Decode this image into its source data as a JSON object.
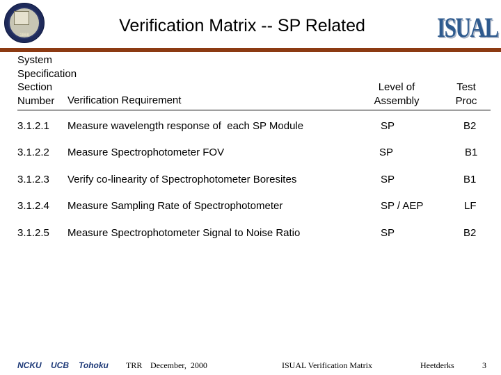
{
  "header": {
    "title": "Verification Matrix  -- SP Related",
    "seal_year": "1868",
    "logo_text": "ISUAL",
    "colors": {
      "rule": "#8c3a12",
      "logo": "#2e5a8e",
      "footer_institutions": "#1e3a78"
    }
  },
  "table": {
    "columns": {
      "section_line1": "System",
      "section_line2": "Specification",
      "section_line3": "Section",
      "section_line4": "Number",
      "requirement": "Verification Requirement",
      "level_line1": "Level of",
      "level_line2": "Assembly",
      "proc_line1": "Test",
      "proc_line2": "Proc"
    },
    "rows": [
      {
        "section": "3.1.2.1",
        "requirement": "Measure wavelength response of  each SP Module",
        "level": "SP",
        "proc": "B2"
      },
      {
        "section": "3.1.2.2",
        "requirement": "Measure Spectrophotometer FOV",
        "level": "SP",
        "proc": "B1"
      },
      {
        "section": "3.1.2.3",
        "requirement": "Verify co-linearity of Spectrophotometer Boresites",
        "level": "SP",
        "proc": "B1"
      },
      {
        "section": "3.1.2.4",
        "requirement": "Measure Sampling Rate of Spectrophotometer",
        "level": "SP / AEP",
        "proc": "LF"
      },
      {
        "section": "3.1.2.5",
        "requirement": "Measure Spectrophotometer Signal to Noise Ratio",
        "level": "SP",
        "proc": "B2"
      }
    ]
  },
  "footer": {
    "inst1": "NCKU",
    "inst2": "UCB",
    "inst3": "Tohoku",
    "review": "TRR",
    "date": "December,  2000",
    "doc_title": "ISUAL Verification Matrix",
    "author": "Heetderks",
    "page": "3"
  }
}
